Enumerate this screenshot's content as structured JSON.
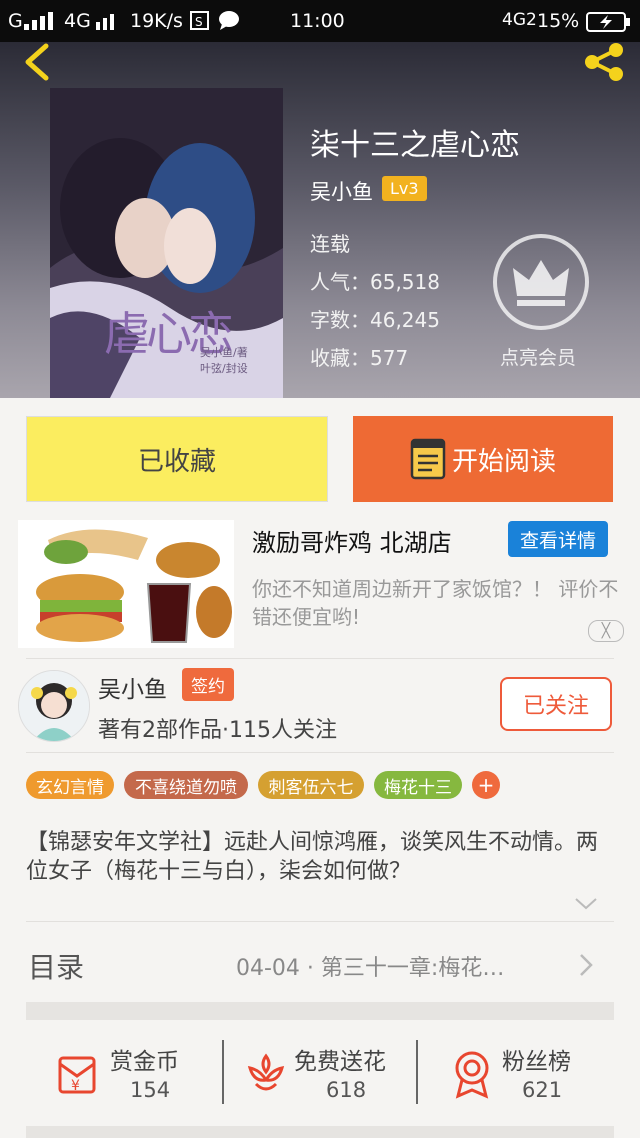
{
  "status_bar": {
    "carrier": "G",
    "network": "4G",
    "speed": "19K/s",
    "time": "11:00",
    "network2": "4G2",
    "battery": "15%"
  },
  "book": {
    "title": "柒十三之虐心恋",
    "author": "吴小鱼",
    "level": "Lv3",
    "status": "连载",
    "popularity": "人气：65,518",
    "word_count": "字数：46,245",
    "favorites": "收藏：577",
    "cover_text": "虐心恋",
    "cover_sub1": "吴小鱼/著",
    "cover_sub2": "叶弦/封设"
  },
  "member": {
    "label": "点亮会员"
  },
  "actions": {
    "favorited_label": "已收藏",
    "read_label": "开始阅读"
  },
  "ad": {
    "title": "激励哥炸鸡 北湖店",
    "details_label": "查看详情",
    "description": "你还不知道周边新开了家饭馆？！ 评价不错还便宜哟!",
    "close_label": "╳"
  },
  "author_card": {
    "name": "吴小鱼",
    "badge": "签约",
    "stats": "著有2部作品·115人关注",
    "follow_label": "已关注"
  },
  "tags": [
    "玄幻言情",
    "不喜绕道勿喷",
    "刺客伍六七",
    "梅花十三"
  ],
  "tag_add": "+",
  "synopsis": "【锦瑟安年文学社】远赴人间惊鸿雁，谈笑风生不动情。两位女子（梅花十三与白），柒会如何做？",
  "catalog": {
    "label": "目录",
    "latest": "04-04 · 第三十一章:梅花…"
  },
  "stats": [
    {
      "label": "赏金币",
      "value": "154"
    },
    {
      "label": "免费送花",
      "value": "618"
    },
    {
      "label": "粉丝榜",
      "value": "621"
    }
  ],
  "colors": {
    "accent_orange": "#ee6a34",
    "favorite_yellow": "#fbed5f",
    "level_badge": "#f2b21f",
    "ad_button": "#1a82d9",
    "follow_red": "#ee5a3a"
  }
}
